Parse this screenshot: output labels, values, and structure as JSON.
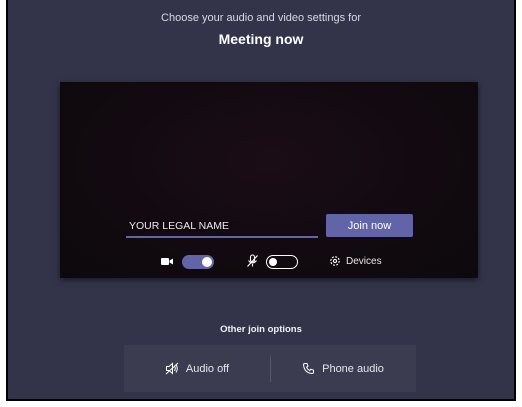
{
  "header": {
    "subtitle": "Choose your audio and video settings for",
    "title": "Meeting now"
  },
  "preview": {
    "name_input": {
      "value": "YOUR LEGAL NAME",
      "placeholder": ""
    },
    "join_label": "Join now"
  },
  "controls": {
    "camera_toggle": "on",
    "mic_toggle": "off",
    "devices_label": "Devices"
  },
  "other_options": {
    "label": "Other join options",
    "audio_off_label": "Audio off",
    "phone_audio_label": "Phone audio"
  },
  "colors": {
    "background": "#33344a",
    "accent": "#6264a7",
    "preview": "#120a10"
  }
}
